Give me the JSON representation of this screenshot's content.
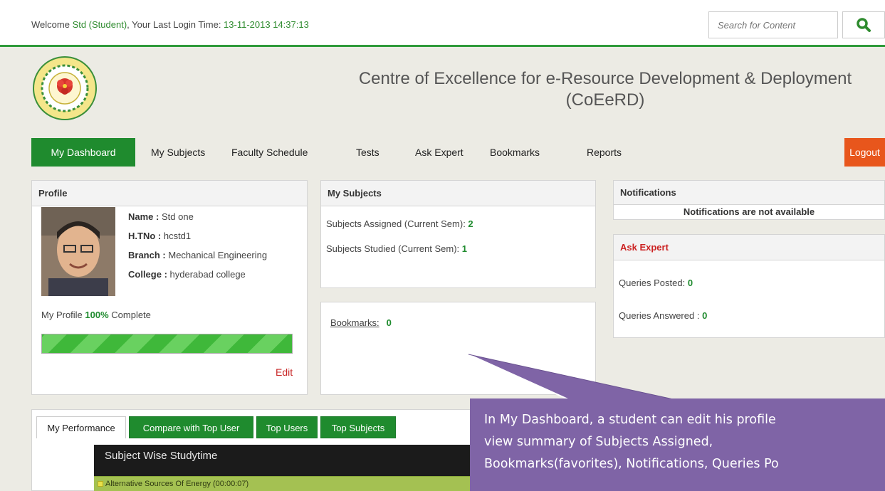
{
  "topbar": {
    "welcome_prefix": "Welcome ",
    "user": "Std (Student)",
    "welcome_mid": ", Your Last Login Time: ",
    "last_login": "13-11-2013 14:37:13",
    "search_placeholder": "Search for Content"
  },
  "header": {
    "title_line1": "Centre of Excellence for e-Resource Development & Deployment",
    "title_line2": "(CoEeRD)"
  },
  "nav": {
    "items": [
      "My Dashboard",
      "My Subjects",
      "Faculty Schedule",
      "Tests",
      "Ask Expert",
      "Bookmarks",
      "Reports"
    ],
    "logout": "Logout"
  },
  "profile": {
    "title": "Profile",
    "name_label": "Name :",
    "name": "Std one",
    "htno_label": "H.TNo :",
    "htno": "hcstd1",
    "branch_label": "Branch :",
    "branch": "Mechanical Engineering",
    "college_label": "College :",
    "college": "hyderabad college",
    "complete_prefix": "My Profile ",
    "complete_pct": "100%",
    "complete_suffix": " Complete",
    "progress_fraction": 1.0,
    "edit": "Edit"
  },
  "subjects": {
    "title": "My Subjects",
    "assigned_label": "Subjects Assigned (Current Sem): ",
    "assigned": "2",
    "studied_label": "Subjects Studied (Current Sem): ",
    "studied": "1"
  },
  "bookmarks": {
    "label": "Bookmarks:",
    "count": "0"
  },
  "notifications": {
    "title": "Notifications",
    "empty": "Notifications are not available"
  },
  "ask_expert": {
    "title": "Ask Expert",
    "posted_label": "Queries Posted: ",
    "posted": "0",
    "answered_label": "Queries Answered : ",
    "answered": "0"
  },
  "tabs": [
    "My Performance",
    "Compare with Top User",
    "Top Users",
    "Top Subjects"
  ],
  "chart": {
    "title": "Subject Wise Studytime",
    "row": "Alternative Sources Of Energy (00:00:07)"
  },
  "callout": {
    "line1": "In My Dashboard, a student can edit his profile",
    "line2": "view summary of Subjects Assigned,",
    "line3": "Bookmarks(favorites), Notifications, Queries Po"
  },
  "colors": {
    "nav_active": "#1f8b2e",
    "logout": "#e8561c",
    "accent_green": "#1f8b2e",
    "ask_expert_title": "#cc2222",
    "callout_bg": "#7f64a6"
  }
}
